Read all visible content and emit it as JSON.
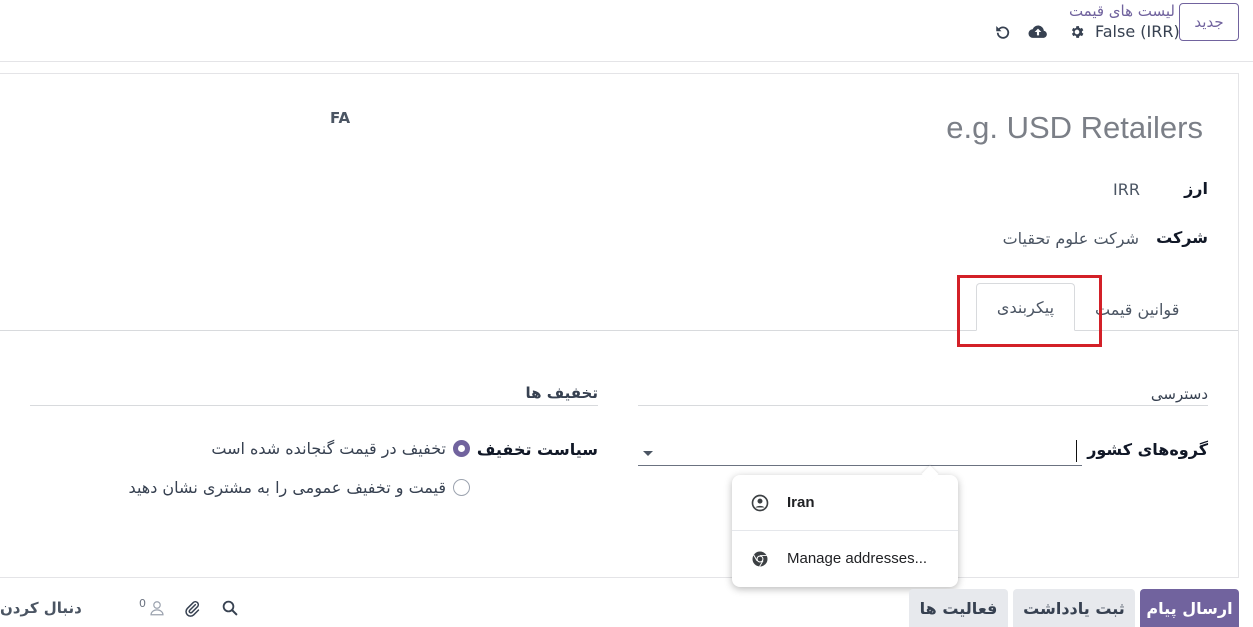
{
  "topbar": {
    "new_label": "جدید",
    "breadcrumb_title": "لیست های قیمت",
    "record_name": "False (IRR)"
  },
  "form": {
    "name_placeholder": "e.g. USD Retailers",
    "lang_badge": "FA",
    "currency_label": "ارز",
    "currency_value": "IRR",
    "company_label": "شرکت",
    "company_value": "شرکت علوم تحقیات"
  },
  "tabs": [
    {
      "label": "قوانین قیمت",
      "active": false
    },
    {
      "label": "پیکربندی",
      "active": true
    }
  ],
  "config": {
    "access_title": "دسترسی",
    "discount_title": "تخفیف ها",
    "country_groups_label": "گروه‌های کشور",
    "country_groups_value": "",
    "discount_policy_label": "سیاست تخفیف",
    "discount_options": [
      {
        "label": "تخفیف در قیمت گنجانده شده است",
        "selected": true
      },
      {
        "label": "قیمت و تخفیف عمومی را به مشتری نشان دهید",
        "selected": false
      }
    ]
  },
  "autofill": {
    "items": [
      {
        "label": "Iran",
        "icon": "person-circle-icon"
      },
      {
        "label": "Manage addresses...",
        "icon": "chrome-icon"
      }
    ]
  },
  "chatter": {
    "send_message": "ارسال پیام",
    "log_note": "ثبت یادداشت",
    "activities": "فعالیت ها",
    "follower_count": "0",
    "follow": "دنبال کردن"
  },
  "colors": {
    "accent": "#71639e",
    "highlight_box": "#d32028"
  }
}
